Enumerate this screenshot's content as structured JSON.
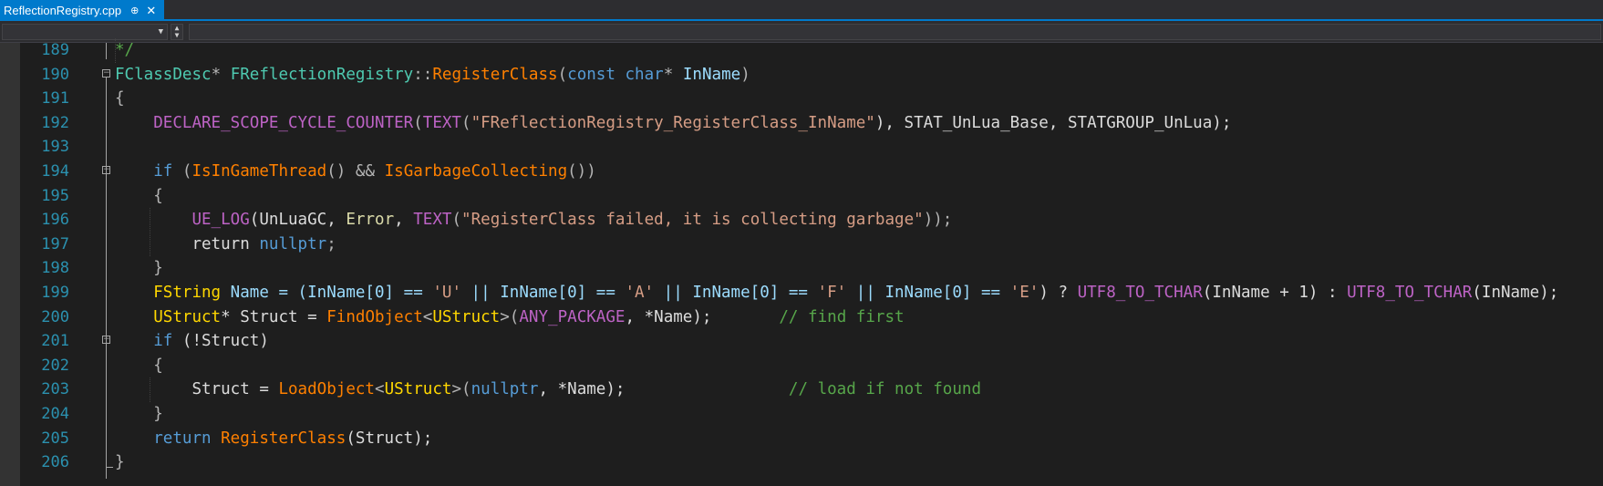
{
  "tab": {
    "title": "ReflectionRegistry.cpp",
    "pin_glyph": "⊕",
    "close_glyph": "✕"
  },
  "colors": {
    "accent": "#007acc",
    "keyword": "#569cd6",
    "type": "#4ec9b0",
    "function": "#dcdcaa",
    "macro": "#bd63c5",
    "string": "#d69d85",
    "comment": "#57a64a",
    "text": "#dcdcdc",
    "line_number": "#2b91af"
  },
  "icons": {
    "fold": "collapse-box-icon",
    "dropdown": "chevron-down-icon"
  },
  "lines": [
    {
      "n": "189",
      "tokens": [
        {
          "t": "*/",
          "c": "#57a64a"
        }
      ]
    },
    {
      "n": "190",
      "tokens": [
        {
          "t": "FClassDesc",
          "c": "#4ec9b0"
        },
        {
          "t": "* ",
          "c": "#b4b4b4"
        },
        {
          "t": "FReflectionRegistry",
          "c": "#4ec9b0"
        },
        {
          "t": "::",
          "c": "#b4b4b4"
        },
        {
          "t": "RegisterClass",
          "c": "#ff8000"
        },
        {
          "t": "(",
          "c": "#b4b4b4"
        },
        {
          "t": "const",
          "c": "#569cd6"
        },
        {
          "t": " ",
          "c": "#dcdcdc"
        },
        {
          "t": "char",
          "c": "#569cd6"
        },
        {
          "t": "* ",
          "c": "#b4b4b4"
        },
        {
          "t": "InName",
          "c": "#9cdcfe"
        },
        {
          "t": ")",
          "c": "#b4b4b4"
        }
      ]
    },
    {
      "n": "191",
      "tokens": [
        {
          "t": "{",
          "c": "#b4b4b4"
        }
      ]
    },
    {
      "n": "192",
      "tokens": [
        {
          "t": "    DECLARE_SCOPE_CYCLE_COUNTER",
          "c": "#bd63c5"
        },
        {
          "t": "(",
          "c": "#b4b4b4"
        },
        {
          "t": "TEXT",
          "c": "#bd63c5"
        },
        {
          "t": "(",
          "c": "#b4b4b4"
        },
        {
          "t": "\"FReflectionRegistry_RegisterClass_InName\"",
          "c": "#d69d85"
        },
        {
          "t": "), STAT_UnLua_Base, STATGROUP_UnLua);",
          "c": "#dcdcdc"
        }
      ]
    },
    {
      "n": "193",
      "tokens": []
    },
    {
      "n": "194",
      "tokens": [
        {
          "t": "    if ",
          "c": "#569cd6"
        },
        {
          "t": "(",
          "c": "#b4b4b4"
        },
        {
          "t": "IsInGameThread",
          "c": "#ff8000"
        },
        {
          "t": "() && ",
          "c": "#b4b4b4"
        },
        {
          "t": "IsGarbageCollecting",
          "c": "#ff8000"
        },
        {
          "t": "())",
          "c": "#b4b4b4"
        }
      ]
    },
    {
      "n": "195",
      "tokens": [
        {
          "t": "    {",
          "c": "#b4b4b4"
        }
      ]
    },
    {
      "n": "196",
      "tokens": [
        {
          "t": "        UE_LOG",
          "c": "#bd63c5"
        },
        {
          "t": "(UnLuaGC, ",
          "c": "#dcdcdc"
        },
        {
          "t": "Error",
          "c": "#dcdcaa"
        },
        {
          "t": ", ",
          "c": "#dcdcdc"
        },
        {
          "t": "TEXT",
          "c": "#bd63c5"
        },
        {
          "t": "(",
          "c": "#b4b4b4"
        },
        {
          "t": "\"RegisterClass failed, it is collecting garbage\"",
          "c": "#d69d85"
        },
        {
          "t": "));",
          "c": "#b4b4b4"
        }
      ]
    },
    {
      "n": "197",
      "tokens": [
        {
          "t": "        return ",
          "c": "#dcdcdc"
        },
        {
          "t": "nullptr",
          "c": "#569cd6"
        },
        {
          "t": ";",
          "c": "#b4b4b4"
        }
      ]
    },
    {
      "n": "198",
      "tokens": [
        {
          "t": "    }",
          "c": "#b4b4b4"
        }
      ]
    },
    {
      "n": "199",
      "tokens": [
        {
          "t": "    FString",
          "c": "#ffd700"
        },
        {
          "t": " Name = (InName[0] == ",
          "c": "#9cdcfe"
        },
        {
          "t": "'U'",
          "c": "#d69d85"
        },
        {
          "t": " || InName[0] == ",
          "c": "#9cdcfe"
        },
        {
          "t": "'A'",
          "c": "#d69d85"
        },
        {
          "t": " || InName[0] == ",
          "c": "#9cdcfe"
        },
        {
          "t": "'F'",
          "c": "#d69d85"
        },
        {
          "t": " || InName[0] == ",
          "c": "#9cdcfe"
        },
        {
          "t": "'E'",
          "c": "#d69d85"
        },
        {
          "t": ") ? ",
          "c": "#dcdcdc"
        },
        {
          "t": "UTF8_TO_TCHAR",
          "c": "#bd63c5"
        },
        {
          "t": "(InName + 1) : ",
          "c": "#dcdcdc"
        },
        {
          "t": "UTF8_TO_TCHAR",
          "c": "#bd63c5"
        },
        {
          "t": "(InName);",
          "c": "#dcdcdc"
        }
      ]
    },
    {
      "n": "200",
      "tokens": [
        {
          "t": "    UStruct",
          "c": "#ffd700"
        },
        {
          "t": "* Struct = ",
          "c": "#dcdcdc"
        },
        {
          "t": "FindObject",
          "c": "#ff8000"
        },
        {
          "t": "<",
          "c": "#b4b4b4"
        },
        {
          "t": "UStruct",
          "c": "#ffd700"
        },
        {
          "t": ">(",
          "c": "#b4b4b4"
        },
        {
          "t": "ANY_PACKAGE",
          "c": "#bd63c5"
        },
        {
          "t": ", *Name);       ",
          "c": "#dcdcdc"
        },
        {
          "t": "// find first",
          "c": "#57a64a"
        }
      ]
    },
    {
      "n": "201",
      "tokens": [
        {
          "t": "    if ",
          "c": "#569cd6"
        },
        {
          "t": "(!Struct)",
          "c": "#dcdcdc"
        }
      ]
    },
    {
      "n": "202",
      "tokens": [
        {
          "t": "    {",
          "c": "#b4b4b4"
        }
      ]
    },
    {
      "n": "203",
      "tokens": [
        {
          "t": "        Struct = ",
          "c": "#dcdcdc"
        },
        {
          "t": "LoadObject",
          "c": "#ff8000"
        },
        {
          "t": "<",
          "c": "#b4b4b4"
        },
        {
          "t": "UStruct",
          "c": "#ffd700"
        },
        {
          "t": ">(",
          "c": "#b4b4b4"
        },
        {
          "t": "nullptr",
          "c": "#569cd6"
        },
        {
          "t": ", *Name);                 ",
          "c": "#dcdcdc"
        },
        {
          "t": "// load if not found",
          "c": "#57a64a"
        }
      ]
    },
    {
      "n": "204",
      "tokens": [
        {
          "t": "    }",
          "c": "#b4b4b4"
        }
      ]
    },
    {
      "n": "205",
      "tokens": [
        {
          "t": "    return ",
          "c": "#569cd6"
        },
        {
          "t": "RegisterClass",
          "c": "#ff8000"
        },
        {
          "t": "(Struct);",
          "c": "#dcdcdc"
        }
      ]
    },
    {
      "n": "206",
      "tokens": [
        {
          "t": "}",
          "c": "#b4b4b4"
        }
      ]
    }
  ]
}
